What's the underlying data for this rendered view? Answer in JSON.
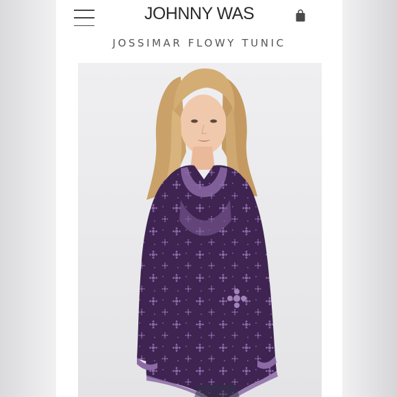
{
  "header": {
    "brand": "JOHNNY WAS",
    "menu_icon": "hamburger-menu-icon",
    "bag_icon": "shopping-bag-icon"
  },
  "product": {
    "title": "JOSSIMAR FLOWY TUNIC",
    "image_description_icon": "product-photo"
  },
  "colors": {
    "brand_text": "#2b2b2b",
    "tunic_purple": "#3f2452",
    "embroidery": "#8c6aa6"
  }
}
